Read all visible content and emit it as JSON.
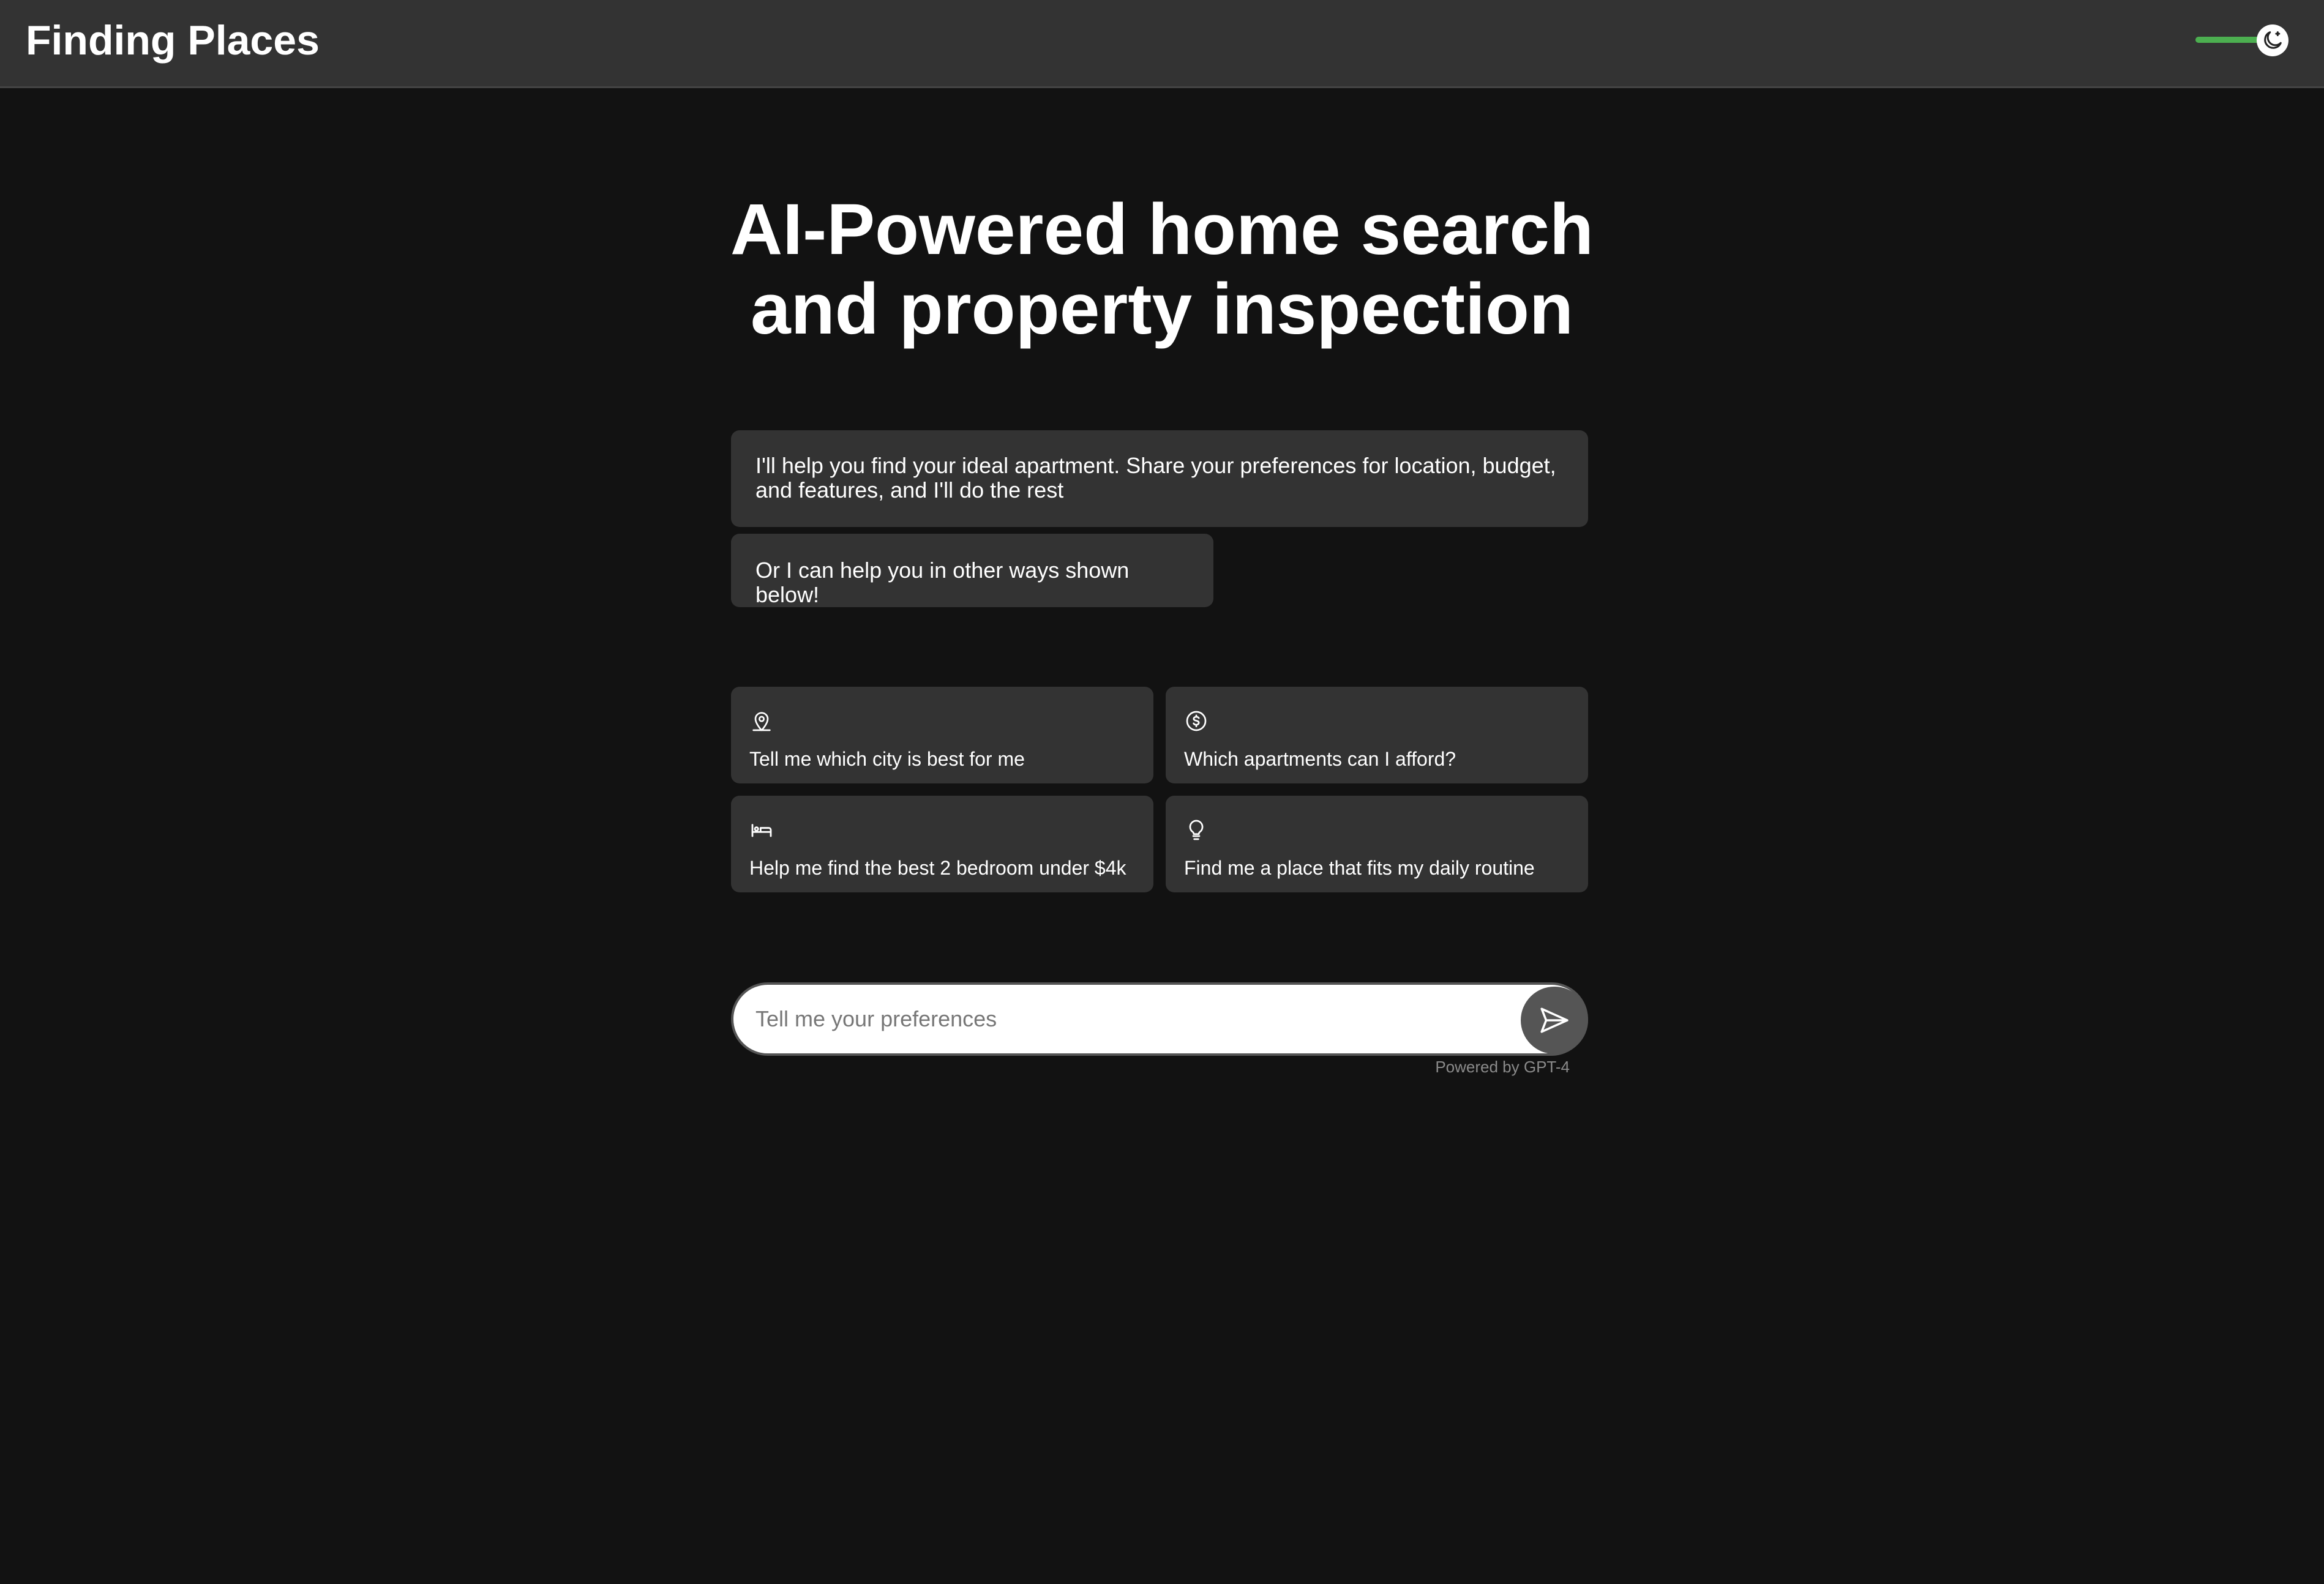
{
  "header": {
    "app_title": "Finding Places",
    "theme_toggle": {
      "mode": "dark",
      "track_color": "#4caf50",
      "icon": "moon-icon"
    }
  },
  "hero": {
    "title": "AI-Powered home search and property inspection"
  },
  "messages": [
    {
      "text": "I'll help you find your ideal apartment. Share your preferences for location, budget, and features, and I'll do the rest"
    },
    {
      "text": "Or I can help you in other ways shown below!"
    }
  ],
  "suggestions": [
    {
      "icon": "map-pin-icon",
      "label": "Tell me which city is best for me"
    },
    {
      "icon": "dollar-circle-icon",
      "label": "Which apartments can I afford?"
    },
    {
      "icon": "bed-icon",
      "label": "Help me find the best 2 bedroom under $4k"
    },
    {
      "icon": "lightbulb-icon",
      "label": "Find me a place that fits my daily routine"
    }
  ],
  "chat": {
    "placeholder": "Tell me your preferences",
    "value": "",
    "send_icon": "send-icon",
    "powered_by": "Powered by GPT-4"
  },
  "colors": {
    "background": "#121212",
    "topbar": "#333333",
    "card": "#333333",
    "accent": "#4caf50"
  }
}
